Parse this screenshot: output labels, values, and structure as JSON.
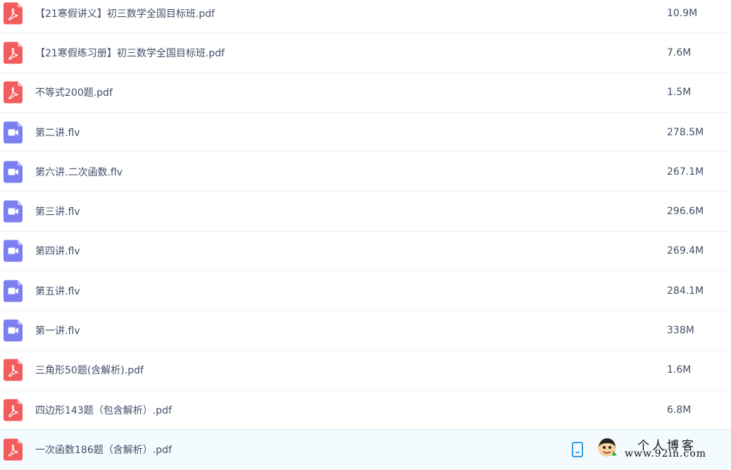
{
  "files": [
    {
      "name": "【21寒假讲义】初三数学全国目标班.pdf",
      "size": "10.9M",
      "type": "pdf",
      "icon": "pdf-icon"
    },
    {
      "name": "【21寒假练习册】初三数学全国目标班.pdf",
      "size": "7.6M",
      "type": "pdf",
      "icon": "pdf-icon"
    },
    {
      "name": "不等式200题.pdf",
      "size": "1.5M",
      "type": "pdf",
      "icon": "pdf-icon"
    },
    {
      "name": "第二讲.flv",
      "size": "278.5M",
      "type": "video",
      "icon": "video-icon"
    },
    {
      "name": "第六讲.二次函数.flv",
      "size": "267.1M",
      "type": "video",
      "icon": "video-icon"
    },
    {
      "name": "第三讲.flv",
      "size": "296.6M",
      "type": "video",
      "icon": "video-icon"
    },
    {
      "name": "第四讲.flv",
      "size": "269.4M",
      "type": "video",
      "icon": "video-icon"
    },
    {
      "name": "第五讲.flv",
      "size": "284.1M",
      "type": "video",
      "icon": "video-icon"
    },
    {
      "name": "第一讲.flv",
      "size": "338M",
      "type": "video",
      "icon": "video-icon"
    },
    {
      "name": "三角形50题(含解析).pdf",
      "size": "1.6M",
      "type": "pdf",
      "icon": "pdf-icon"
    },
    {
      "name": "四边形143题（包含解析）.pdf",
      "size": "6.8M",
      "type": "pdf",
      "icon": "pdf-icon"
    },
    {
      "name": "一次函数186题（含解析）.pdf",
      "size": "",
      "type": "pdf",
      "icon": "pdf-icon"
    }
  ],
  "hover_row_action": {
    "icon": "mobile-phone-icon"
  },
  "watermark": {
    "title": "个人博客",
    "url": "www.92in.com"
  },
  "colors": {
    "pdf": "#f25c5c",
    "video": "#7b7ff0",
    "text": "#424e67",
    "hover_bg": "#f4fbff",
    "phone_icon": "#3b9ae1"
  }
}
